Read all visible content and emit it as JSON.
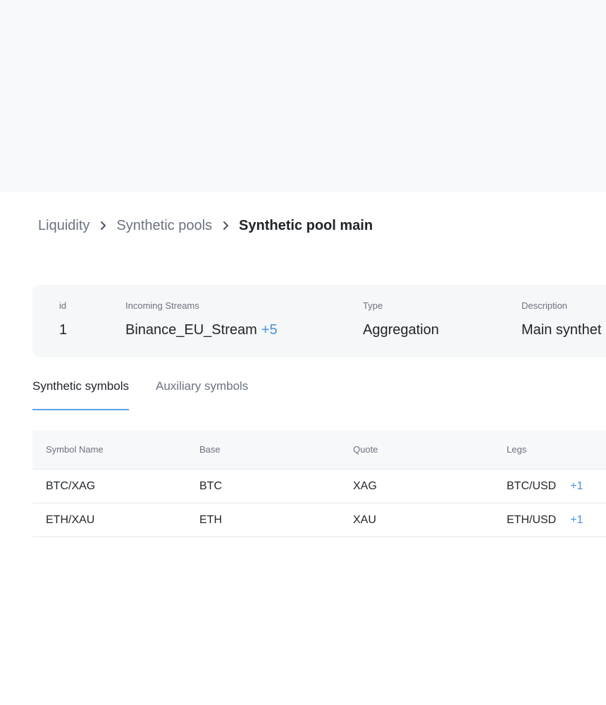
{
  "breadcrumb": {
    "items": [
      {
        "label": "Liquidity"
      },
      {
        "label": "Synthetic pools"
      },
      {
        "label": "Synthetic pool main"
      }
    ]
  },
  "info": {
    "id": {
      "label": "id",
      "value": "1"
    },
    "streams": {
      "label": "Incoming Streams",
      "value": "Binance_EU_Stream",
      "more": "+5"
    },
    "type": {
      "label": "Type",
      "value": "Aggregation"
    },
    "description": {
      "label": "Description",
      "value": "Main synthet"
    }
  },
  "tabs": [
    {
      "label": "Synthetic symbols",
      "active": true
    },
    {
      "label": "Auxiliary symbols",
      "active": false
    }
  ],
  "table": {
    "headers": [
      "Symbol Name",
      "Base",
      "Quote",
      "Legs"
    ],
    "rows": [
      {
        "symbol": "BTC/XAG",
        "base": "BTC",
        "quote": "XAG",
        "legs": "BTC/USD",
        "legs_more": "+1"
      },
      {
        "symbol": "ETH/XAU",
        "base": "ETH",
        "quote": "XAU",
        "legs": "ETH/USD",
        "legs_more": "+1"
      }
    ]
  },
  "colors": {
    "accent": "#4a90e2",
    "tab_underline": "#5da3e6",
    "top_bg": "#f8f9fa",
    "card_bg": "#f5f7f8"
  }
}
